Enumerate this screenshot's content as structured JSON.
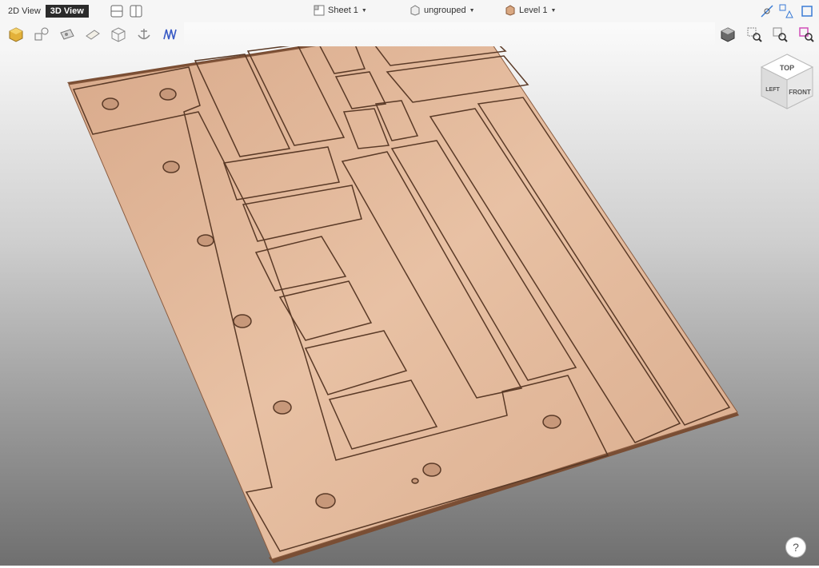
{
  "header": {
    "view_2d": "2D View",
    "view_3d": "3D View",
    "sheet": "Sheet 1",
    "group": "ungrouped",
    "level": "Level 1"
  },
  "view_cube": {
    "top": "TOP",
    "front": "FRONT",
    "left": "LEFT"
  },
  "help": {
    "label": "?"
  },
  "colors": {
    "wood": "#e1b697",
    "wood_edge": "#5a3a27",
    "active_view": "#2b2b2b",
    "accent_blue": "#3a7bd5",
    "accent_pink": "#d04fb8"
  }
}
